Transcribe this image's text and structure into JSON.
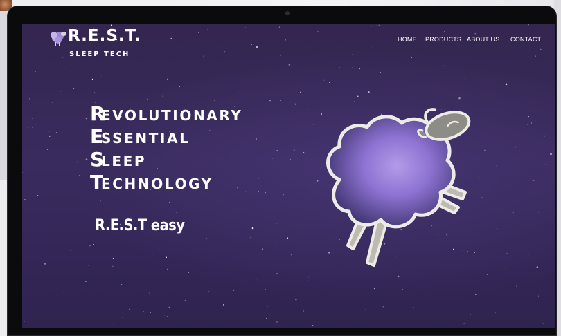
{
  "brand": {
    "title": "R.E.S.T.",
    "subtitle": "SLEEP TECH"
  },
  "nav": {
    "items": [
      {
        "label": "HOME"
      },
      {
        "label": "PRODUCTS"
      },
      {
        "label": "ABOUT US"
      },
      {
        "label": "CONTACT"
      }
    ]
  },
  "hero": {
    "acronym": [
      {
        "first": "R",
        "rest": "EVOLUTIONARY"
      },
      {
        "first": "E",
        "rest": "SSENTIAL"
      },
      {
        "first": "S",
        "rest": "LEEP"
      },
      {
        "first": "T",
        "rest": "ECHNOLOGY"
      }
    ],
    "tagline": "R.E.S.T  easy"
  },
  "colors": {
    "background": "#33264f",
    "text": "#ffffff",
    "sheep_outline": "#e8e6e0",
    "sheep_body": "#8b6fcf"
  },
  "icons": {
    "logo": "sheep-icon",
    "illustration": "sheep-illustration"
  }
}
